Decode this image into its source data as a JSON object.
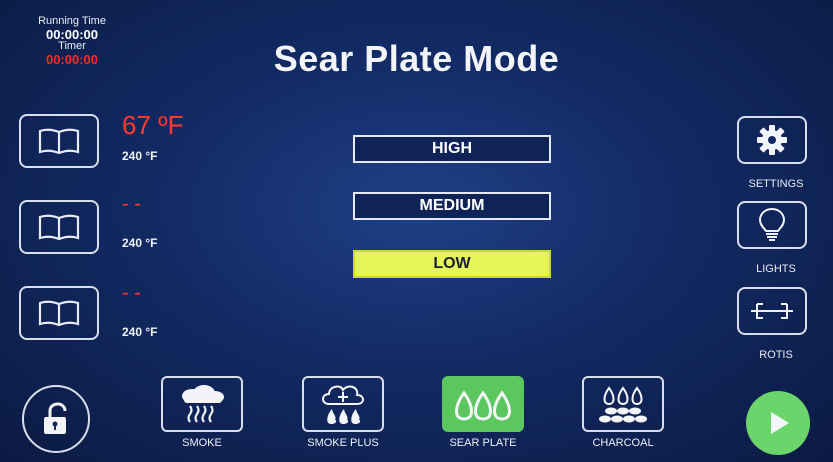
{
  "timers": {
    "running_label": "Running Time",
    "running_value": "00:00:00",
    "timer_label": "Timer",
    "timer_value": "00:00:00"
  },
  "title": "Sear Plate Mode",
  "probes": [
    {
      "current": "67 ºF",
      "setpoint": "240 °F"
    },
    {
      "current": "- -",
      "setpoint": "240 °F"
    },
    {
      "current": "- -",
      "setpoint": "240 °F"
    }
  ],
  "modes": {
    "high": "HIGH",
    "medium": "MEDIUM",
    "low": "LOW",
    "selected": "LOW"
  },
  "side": {
    "settings": "SETTINGS",
    "lights": "LIGHTS",
    "rotis": "ROTIS"
  },
  "bottom": {
    "smoke": "SMOKE",
    "smoke_plus": "SMOKE PLUS",
    "sear_plate": "SEAR PLATE",
    "charcoal": "CHARCOAL",
    "selected": "SEAR PLATE"
  },
  "colors": {
    "background": "#122a63",
    "alert_red": "#ff2a1e",
    "active_mode": "#e6f55a",
    "active_green": "#5cc75e",
    "play_green": "#6bd46b"
  },
  "icons": {
    "probe": "book-icon",
    "settings": "gear-icon",
    "lights": "lightbulb-icon",
    "rotis": "rotisserie-icon",
    "lock": "unlock-icon",
    "play": "play-icon"
  }
}
